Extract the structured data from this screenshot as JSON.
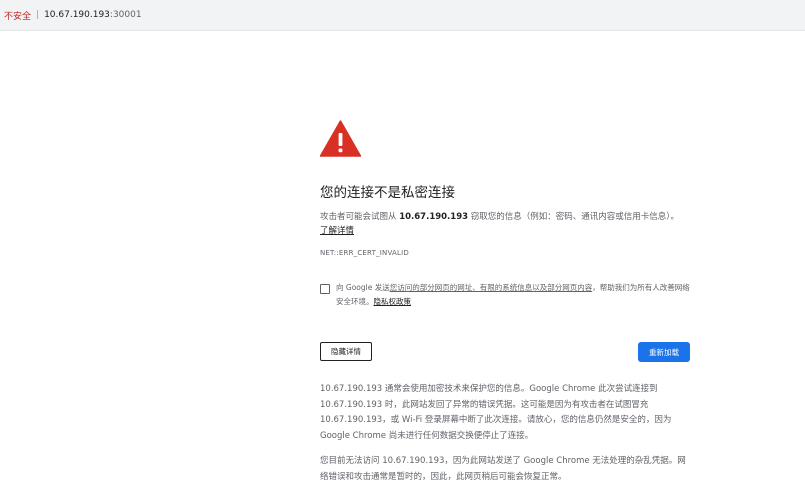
{
  "address_bar": {
    "security_label": "不安全",
    "separator": "|",
    "host": "10.67.190.193",
    "port": ":30001"
  },
  "interstitial": {
    "icon": "warning-triangle-icon",
    "title": "您的连接不是私密连接",
    "description": {
      "part1": "攻击者可能会试图从 ",
      "host": "10.67.190.193",
      "part2": " 窃取您的信息（例如：密码、通讯内容或信用卡信息）。",
      "learn_more": "了解详情"
    },
    "error_code": "NET::ERR_CERT_INVALID",
    "opt_in": {
      "prefix": "向 Google 发送",
      "underlined": "您访问的部分网页的网址、有限的系统信息以及部分网页内容",
      "suffix": "，帮助我们为所有人改善网络安全环境。",
      "privacy_link": "隐私权政策"
    },
    "details_button": "隐藏详情",
    "reload_button": "重新加载",
    "details_paragraphs": [
      "10.67.190.193 通常会使用加密技术来保护您的信息。Google Chrome 此次尝试连接到 10.67.190.193 时，此网站发回了异常的错误凭据。这可能是因为有攻击者在试图冒充 10.67.190.193，或 Wi-Fi 登录屏幕中断了此次连接。请放心，您的信息仍然是安全的，因为 Google Chrome 尚未进行任何数据交换便停止了连接。",
      "您目前无法访问 10.67.190.193，因为此网站发送了 Google Chrome 无法处理的杂乱凭据。网络错误和攻击通常是暂时的，因此，此网页稍后可能会恢复正常。"
    ]
  },
  "colors": {
    "warning_red": "#d93025",
    "button_blue": "#1a73e8",
    "not_secure_red": "#c5221f"
  }
}
